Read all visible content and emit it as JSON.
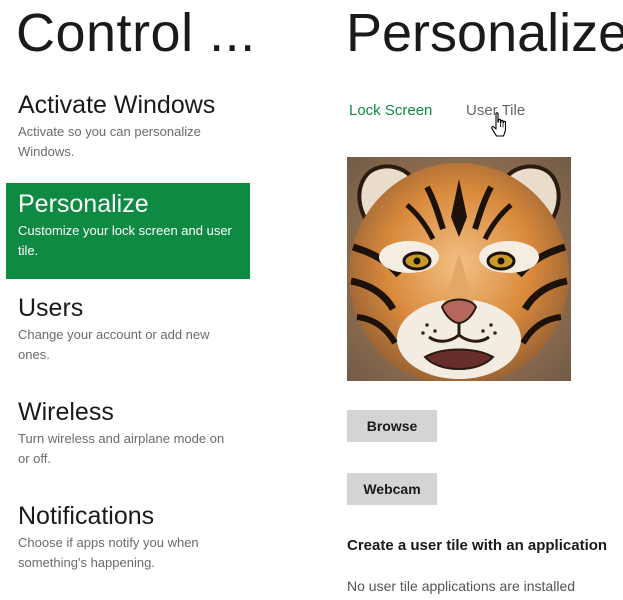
{
  "left": {
    "title": "Control ...",
    "nav": [
      {
        "label": "Activate Windows",
        "desc": "Activate so you can personalize Windows."
      },
      {
        "label": "Personalize",
        "desc": "Customize your lock screen and user tile."
      },
      {
        "label": "Users",
        "desc": "Change your account or add new ones."
      },
      {
        "label": "Wireless",
        "desc": "Turn wireless and airplane mode on or off."
      },
      {
        "label": "Notifications",
        "desc": "Choose if apps notify you when something's happening."
      }
    ],
    "selected_index": 1
  },
  "right": {
    "title": "Personalize",
    "tabs": [
      {
        "label": "Lock Screen",
        "active": true
      },
      {
        "label": "User Tile",
        "active": false
      }
    ],
    "buttons": {
      "browse": "Browse",
      "webcam": "Webcam"
    },
    "section_heading": "Create a user tile with an application",
    "section_note": "No user tile applications are installed"
  },
  "icons": {
    "cursor": "hand-pointer-icon",
    "tile_image": "tiger-user-tile"
  },
  "colors": {
    "accent": "#0e8a43",
    "button_bg": "#d4d4d4",
    "inactive_tab": "#666666"
  }
}
